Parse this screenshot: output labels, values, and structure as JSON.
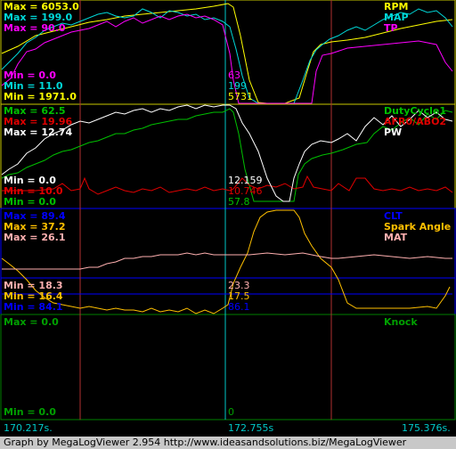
{
  "panels": [
    {
      "max_labels": [
        "Max = 6053.0",
        "Max = 199.0",
        "Max = 90.0"
      ],
      "min_labels": [
        "Min = 0.0",
        "Min = 11.0",
        "Min = 1971.0"
      ],
      "series_names": [
        "RPM",
        "MAP",
        "TP"
      ],
      "cursor_values": [
        "63",
        "199",
        "5731"
      ]
    },
    {
      "max_labels": [
        "Max = 62.5",
        "Max = 19.96",
        "Max = 12.74"
      ],
      "min_labels": [
        "Min = 0.0",
        "Min = 10.0",
        "Min = 0.0"
      ],
      "series_names": [
        "DutyCycle1",
        "AFR0/ABO2",
        "PW"
      ],
      "cursor_values": [
        "12.159",
        "10.746",
        "57.8"
      ]
    },
    {
      "max_labels": [
        "Max = 89.4",
        "Max = 37.2",
        "Max = 26.1"
      ],
      "min_labels": [
        "Min = 18.3",
        "Min = 16.4",
        "Min = 84.1"
      ],
      "series_names": [
        "CLT",
        "Spark Angle",
        "MAT"
      ],
      "cursor_values": [
        "23.3",
        "17.5",
        "86.1"
      ]
    },
    {
      "max_labels": [
        "Max = 0.0"
      ],
      "min_labels": [
        "Min = 0.0"
      ],
      "series_names": [
        "Knock"
      ],
      "cursor_values": [
        "0"
      ]
    }
  ],
  "time_axis": {
    "left": "170.217s.",
    "cursor": "172.755s",
    "right": "175.376s."
  },
  "footer": "Graph by MegaLogViewer 2.954 http://www.ideasandsolutions.biz/MegaLogViewer",
  "colors": {
    "rpm": "#ffff00",
    "map": "#00d8d8",
    "tp": "#ff00ff",
    "duty": "#00c000",
    "afr": "#e00000",
    "pw": "#ffffff",
    "clt": "#0000ff",
    "spark": "#ffc000",
    "mat": "#ffb0b0",
    "knock": "#00a000",
    "cursor": "#00c8c8"
  }
}
